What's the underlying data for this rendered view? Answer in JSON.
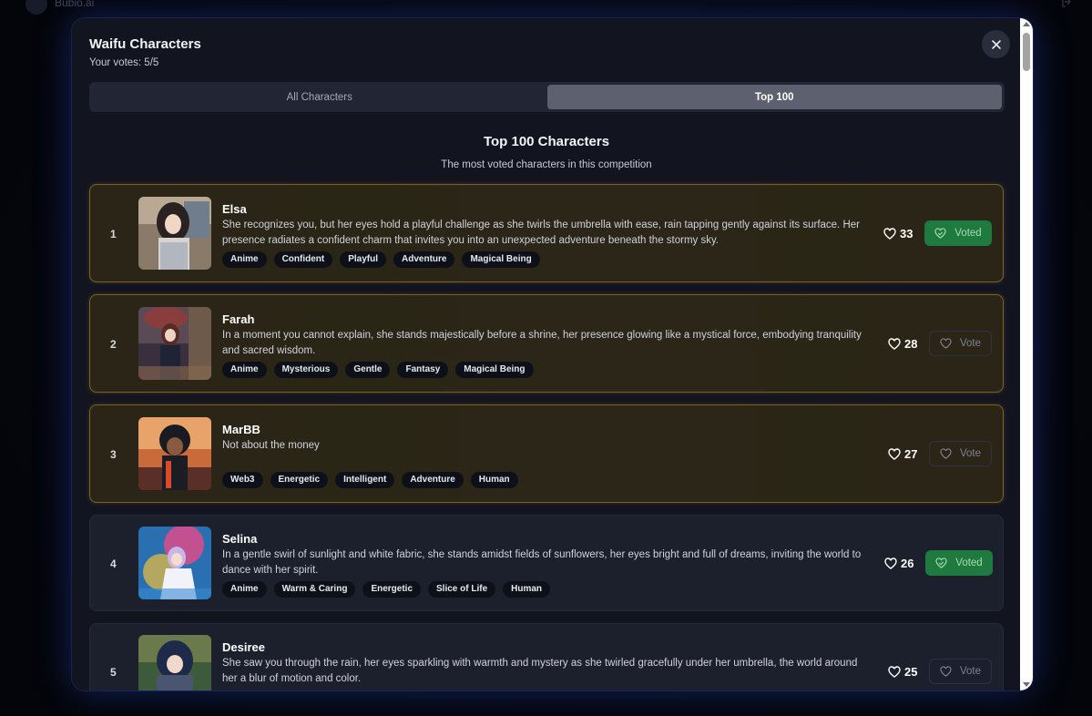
{
  "background": {
    "app_name": "Bubio.ai"
  },
  "modal": {
    "title": "Waifu Characters",
    "subtitle": "Your votes: 5/5",
    "close_icon": "close-icon"
  },
  "tabs": [
    {
      "label": "All Characters",
      "active": false
    },
    {
      "label": "Top 100",
      "active": true
    }
  ],
  "section": {
    "title": "Top 100 Characters",
    "subtitle": "The most voted characters in this competition"
  },
  "characters": [
    {
      "rank": "1",
      "name": "Elsa",
      "description": "She recognizes you, but her eyes hold a playful challenge as she twirls the umbrella with ease, rain tapping gently against its surface. Her presence radiates a confident charm that invites you into an unexpected adventure beneath the stormy sky.",
      "tags": [
        "Anime",
        "Confident",
        "Playful",
        "Adventure",
        "Magical Being"
      ],
      "votes": "33",
      "button": "Voted",
      "highlight": true
    },
    {
      "rank": "2",
      "name": "Farah",
      "description": "In a moment you cannot explain, she stands majestically before a shrine, her presence glowing like a mystical force, embodying tranquility and sacred wisdom.",
      "tags": [
        "Anime",
        "Mysterious",
        "Gentle",
        "Fantasy",
        "Magical Being"
      ],
      "votes": "28",
      "button": "Vote",
      "highlight": true
    },
    {
      "rank": "3",
      "name": "MarBB",
      "description": "Not about the money",
      "tags": [
        "Web3",
        "Energetic",
        "Intelligent",
        "Adventure",
        "Human"
      ],
      "votes": "27",
      "button": "Vote",
      "highlight": true
    },
    {
      "rank": "4",
      "name": "Selina",
      "description": "In a gentle swirl of sunlight and white fabric, she stands amidst fields of sunflowers, her eyes bright and full of dreams, inviting the world to dance with her spirit.",
      "tags": [
        "Anime",
        "Warm & Caring",
        "Energetic",
        "Slice of Life",
        "Human"
      ],
      "votes": "26",
      "button": "Voted",
      "highlight": false
    },
    {
      "rank": "5",
      "name": "Desiree",
      "description": "She saw you through the rain, her eyes sparkling with warmth and mystery as she twirled gracefully under her umbrella, the world around her a blur of motion and color.",
      "tags": [],
      "votes": "25",
      "button": "Vote",
      "highlight": false
    }
  ],
  "colors": {
    "gold_border": "#7a6322",
    "voted_green": "#1f7a3f",
    "modal_bg": "#121420"
  }
}
